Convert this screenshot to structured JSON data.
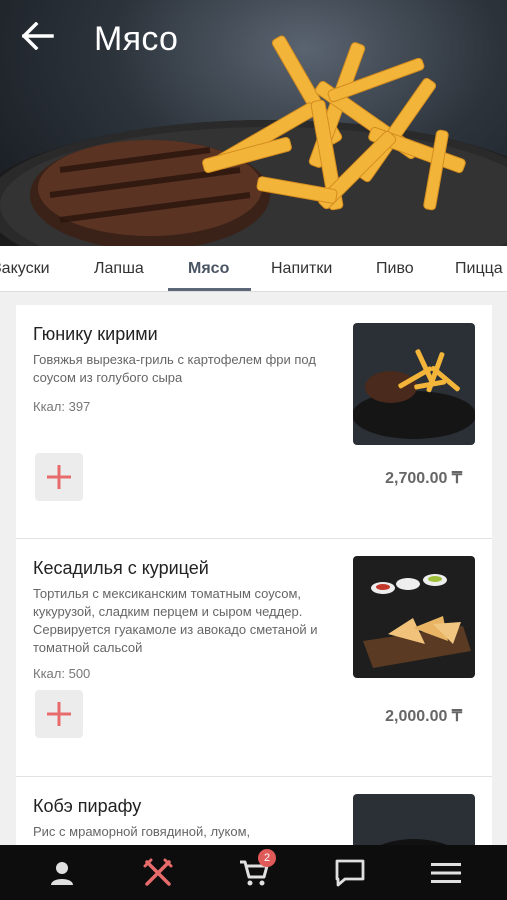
{
  "header": {
    "title": "Мясо"
  },
  "tabs": [
    {
      "label": "Закуски"
    },
    {
      "label": "Лапша"
    },
    {
      "label": "Мясо"
    },
    {
      "label": "Напитки"
    },
    {
      "label": "Пиво"
    },
    {
      "label": "Пицца"
    }
  ],
  "active_tab": "Мясо",
  "items": [
    {
      "title": "Гюнику кирими",
      "description": "Говяжья вырезка-гриль с картофелем фри под соусом из голубого сыра",
      "kcal": "Ккал: 397",
      "price": "2,700.00 ₸"
    },
    {
      "title": "Кесадилья с курицей",
      "description": "Тортилья с мексиканским томатным соусом, кукурузой, сладким перцем и сыром чеддер. Сервируется гуакамоле из авокадо сметаной и томатной сальсой",
      "kcal": "Ккал: 500",
      "price": "2,000.00 ₸"
    },
    {
      "title": "Кобэ пирафу",
      "description": "Рис с мраморной говядиной, луком,"
    }
  ],
  "bottom_nav": {
    "items": [
      "profile-icon",
      "menu-icon",
      "cart-icon",
      "chat-icon",
      "hamburger-icon"
    ],
    "active": "menu-icon",
    "cart_count": "2"
  },
  "colors": {
    "accent": "#e76b6b",
    "nav_bg": "#0d0d0d",
    "price": "#666666"
  }
}
